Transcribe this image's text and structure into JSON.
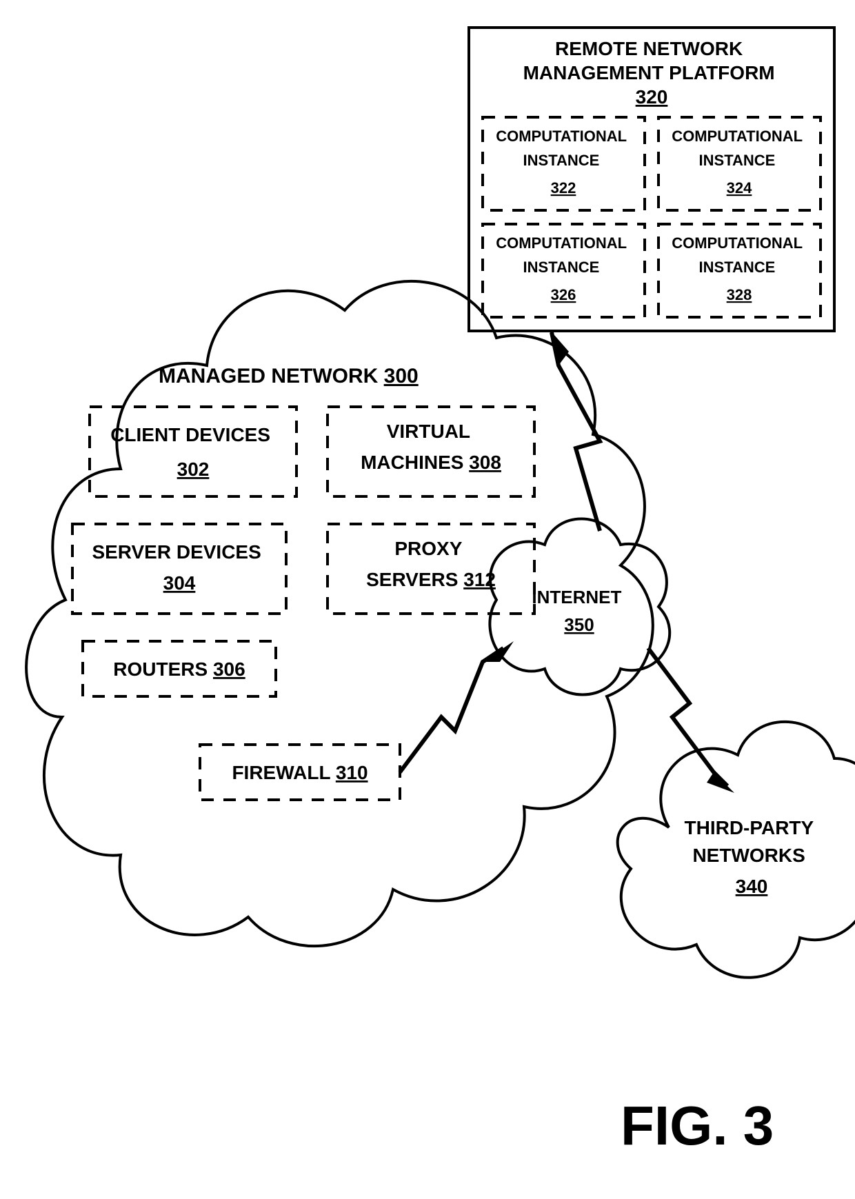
{
  "figure_label": "FIG. 3",
  "managed_network": {
    "title": "MANAGED NETWORK",
    "ref": "300",
    "client_devices": {
      "label": "CLIENT DEVICES",
      "ref": "302"
    },
    "server_devices": {
      "label": "SERVER DEVICES",
      "ref": "304"
    },
    "routers": {
      "label": "ROUTERS",
      "ref": "306"
    },
    "virtual_machines": {
      "label": "VIRTUAL MACHINES",
      "ref": "308"
    },
    "firewall": {
      "label": "FIREWALL",
      "ref": "310"
    },
    "proxy_servers": {
      "label": "PROXY SERVERS",
      "ref": "312"
    }
  },
  "platform": {
    "title_line1": "REMOTE NETWORK",
    "title_line2": "MANAGEMENT PLATFORM",
    "ref": "320",
    "ci322": {
      "label1": "COMPUTATIONAL",
      "label2": "INSTANCE",
      "ref": "322"
    },
    "ci324": {
      "label1": "COMPUTATIONAL",
      "label2": "INSTANCE",
      "ref": "324"
    },
    "ci326": {
      "label1": "COMPUTATIONAL",
      "label2": "INSTANCE",
      "ref": "326"
    },
    "ci328": {
      "label1": "COMPUTATIONAL",
      "label2": "INSTANCE",
      "ref": "328"
    }
  },
  "third_party": {
    "label1": "THIRD-PARTY",
    "label2": "NETWORKS",
    "ref": "340"
  },
  "internet": {
    "label": "INTERNET",
    "ref": "350"
  }
}
